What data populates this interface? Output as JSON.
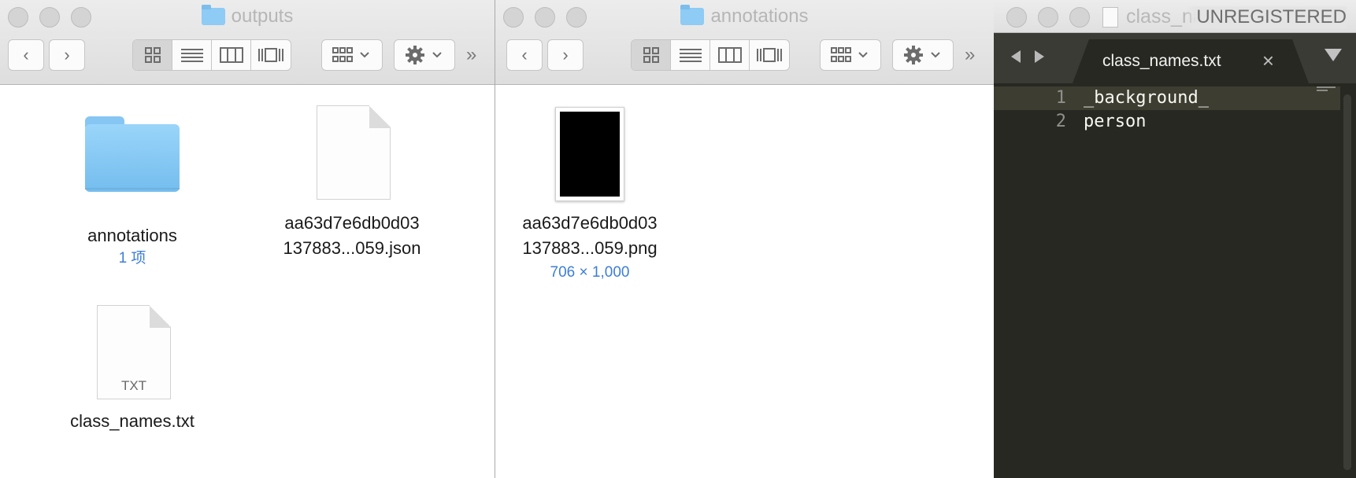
{
  "finder_left": {
    "title": "outputs",
    "items": [
      {
        "name": "annotations",
        "meta": "1 项",
        "icon": "folder-icon"
      },
      {
        "name_line1": "aa63d7e6db0d03",
        "name_line2": "137883...059.json",
        "icon": "json-file-icon"
      },
      {
        "name": "class_names.txt",
        "icon": "txt-file-icon",
        "badge": "TXT"
      }
    ]
  },
  "finder_mid": {
    "title": "annotations",
    "items": [
      {
        "name_line1": "aa63d7e6db0d03",
        "name_line2": "137883...059.png",
        "meta": "706 × 1,000",
        "icon": "png-thumbnail"
      }
    ]
  },
  "editor": {
    "window_title": "class_na",
    "unregistered": "UNREGISTERED",
    "tab_label": "class_names.txt",
    "tab_close": "×",
    "lines": [
      {
        "num": "1",
        "text": "_background_"
      },
      {
        "num": "2",
        "text": "person"
      }
    ]
  },
  "toolbar": {
    "back": "‹",
    "forward": "›",
    "more": "»"
  },
  "colors": {
    "editor_bg": "#272822",
    "meta_blue": "#3d7dd8",
    "folder_blue": "#86c6f3"
  }
}
